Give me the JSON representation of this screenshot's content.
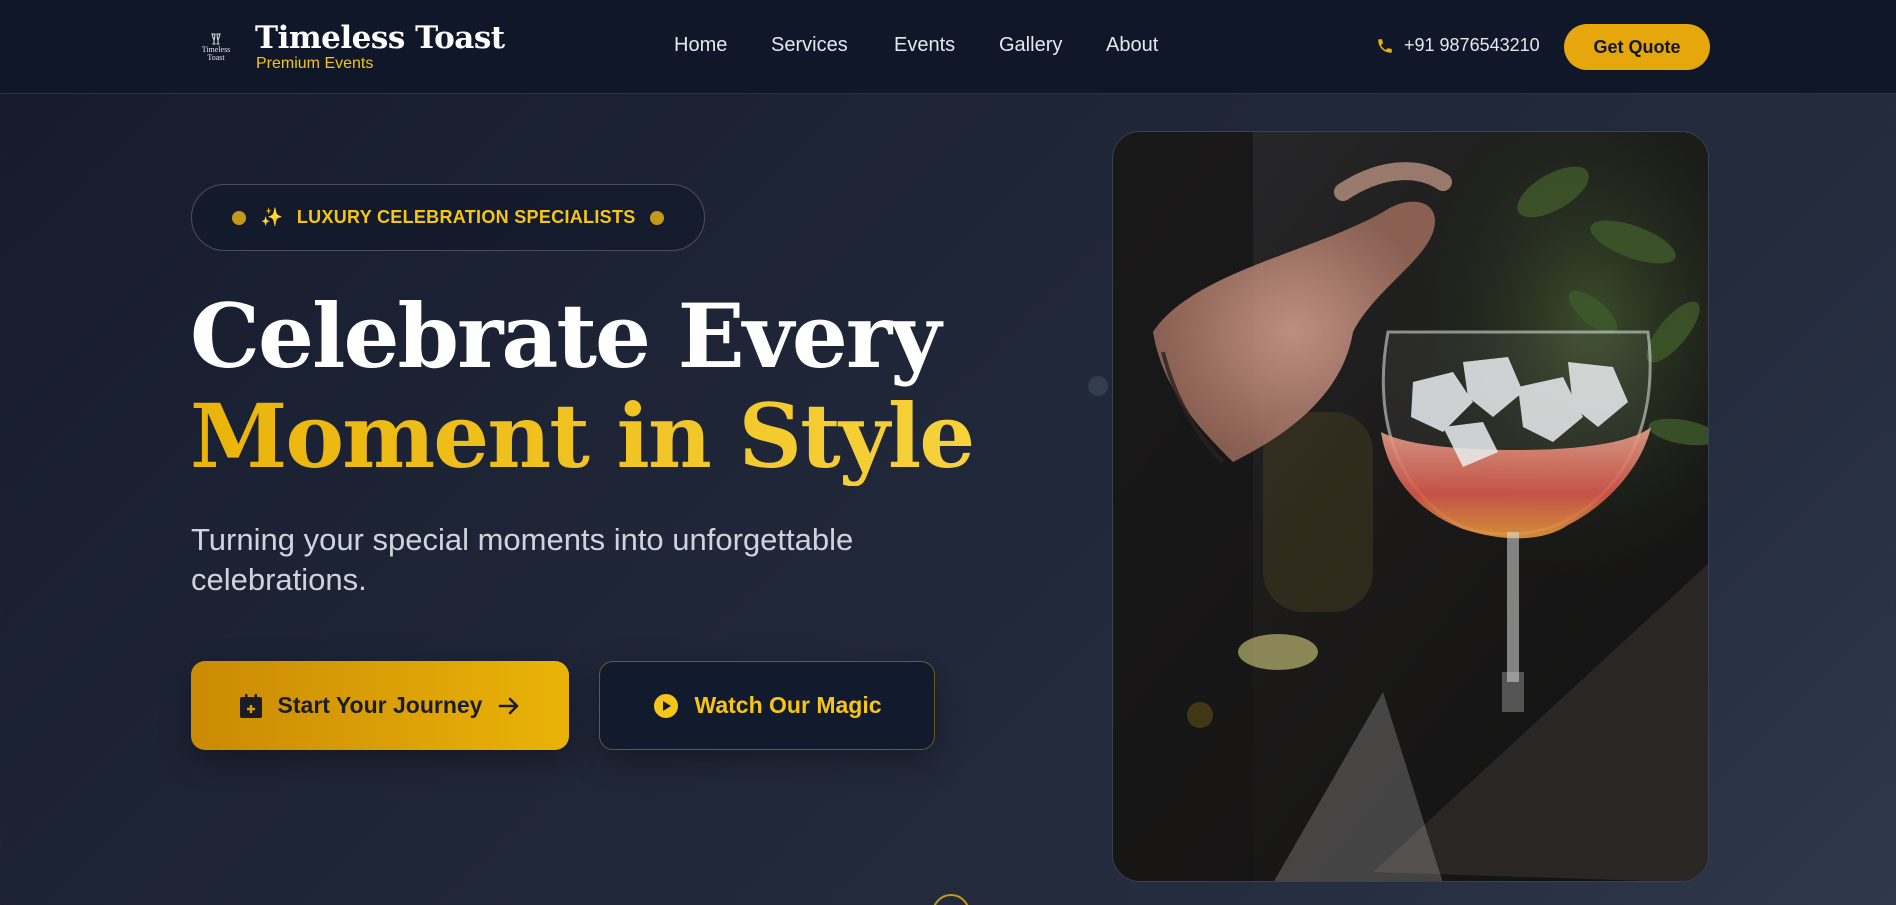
{
  "header": {
    "logo_mark_text": "Timeless Toast",
    "brand_name": "Timeless Toast",
    "brand_sub": "Premium Events",
    "nav": [
      "Home",
      "Services",
      "Events",
      "Gallery",
      "About"
    ],
    "phone_icon": "phone-icon",
    "phone": "+91 9876543210",
    "cta": "Get Quote"
  },
  "hero": {
    "badge_icon": "sparkle-icon",
    "badge": "LUXURY CELEBRATION SPECIALISTS",
    "headline_line1": "Celebrate Every",
    "headline_line2": "Moment in Style",
    "subtitle": "Turning your special moments into unforgettable celebrations.",
    "primary_button": {
      "label": "Start Your Journey",
      "icon": "calendar-plus-icon",
      "trailing_icon": "arrow-right-icon"
    },
    "secondary_button": {
      "label": "Watch Our Magic",
      "icon": "play-circle-icon"
    },
    "image_subject": "cocktail-glass-photo"
  },
  "colors": {
    "accent": "#eab308",
    "accent_text": "#f5c518",
    "header_bg": "#0f1729",
    "page_bg": "#1e2536"
  }
}
